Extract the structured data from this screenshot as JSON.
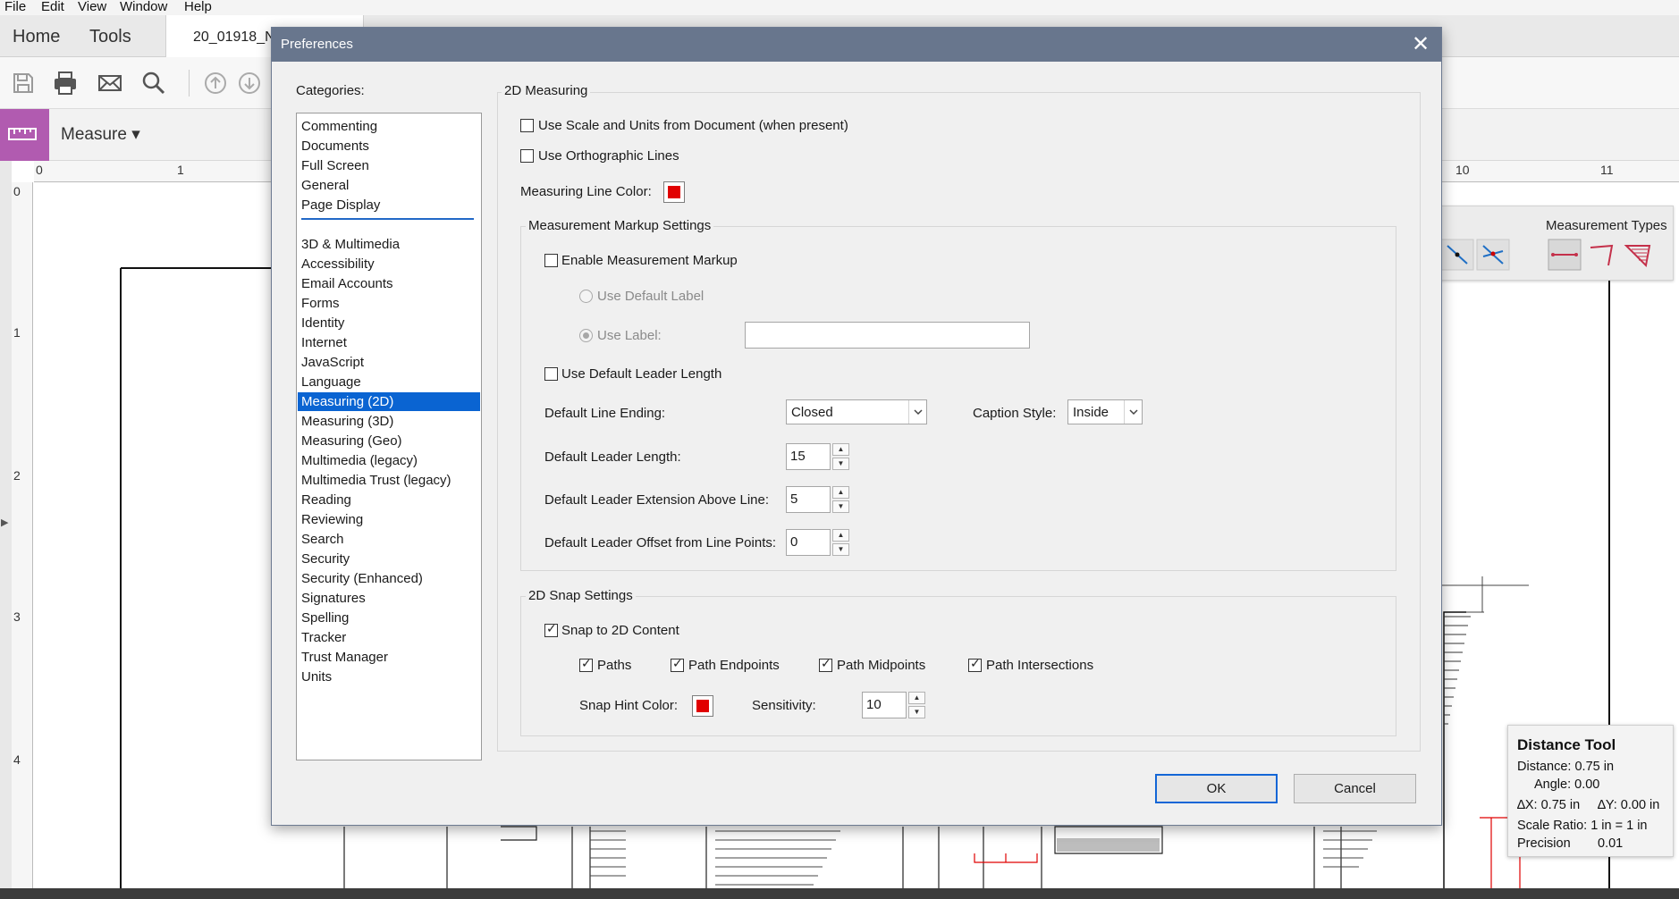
{
  "app": {
    "menu": [
      "File",
      "Edit",
      "View",
      "Window",
      "Help"
    ],
    "tabs": {
      "home": "Home",
      "tools": "Tools",
      "document": "20_01918_N"
    },
    "toolbar_icons": [
      "save-icon",
      "print-icon",
      "email-icon",
      "search-icon",
      "page-up-icon",
      "page-down-icon"
    ],
    "measure_bar": {
      "label": "Measure ▾"
    },
    "ruler_top": [
      "0",
      "1",
      "10",
      "11"
    ],
    "ruler_left": [
      "0",
      "1",
      "2",
      "3",
      "4"
    ],
    "measurement_types_panel": {
      "title": "Measurement Types"
    },
    "distance_tool": {
      "title": "Distance Tool",
      "distance": "Distance: 0.75 in",
      "angle": "Angle: 0.00",
      "delta_x": "∆X: 0.75 in",
      "delta_y": "∆Y: 0.00 in",
      "scale_ratio": "Scale Ratio: 1 in = 1 in",
      "precision": "Precision",
      "precision_value": "0.01"
    }
  },
  "dialog": {
    "title": "Preferences",
    "close_glyph": "✕",
    "categories_label": "Categories:",
    "categories_top": [
      "Commenting",
      "Documents",
      "Full Screen",
      "General",
      "Page Display"
    ],
    "categories_bottom": [
      "3D & Multimedia",
      "Accessibility",
      "Email Accounts",
      "Forms",
      "Identity",
      "Internet",
      "JavaScript",
      "Language",
      "Measuring (2D)",
      "Measuring (3D)",
      "Measuring (Geo)",
      "Multimedia (legacy)",
      "Multimedia Trust (legacy)",
      "Reading",
      "Reviewing",
      "Search",
      "Security",
      "Security (Enhanced)",
      "Signatures",
      "Spelling",
      "Tracker",
      "Trust Manager",
      "Units"
    ],
    "selected_category": "Measuring (2D)",
    "measuring": {
      "group_title": "2D Measuring",
      "use_scale_units": {
        "label": "Use Scale and Units from Document (when present)",
        "checked": false
      },
      "use_orthographic": {
        "label": "Use Orthographic Lines",
        "checked": false
      },
      "line_color": {
        "label": "Measuring Line Color:",
        "color": "#e10000"
      }
    },
    "markup": {
      "group_title": "Measurement Markup Settings",
      "enable_markup": {
        "label": "Enable Measurement Markup",
        "checked": false
      },
      "use_default_label": "Use Default Label",
      "use_label": "Use Label:",
      "label_value": "",
      "use_default_leader": {
        "label": "Use Default Leader Length",
        "checked": false
      },
      "line_ending": {
        "label": "Default Line Ending:",
        "value": "Closed"
      },
      "caption_style": {
        "label": "Caption Style:",
        "value": "Inside"
      },
      "leader_length": {
        "label": "Default Leader Length:",
        "value": "15"
      },
      "leader_extension": {
        "label": "Default Leader Extension Above Line:",
        "value": "5"
      },
      "leader_offset": {
        "label": "Default Leader Offset from Line Points:",
        "value": "0"
      }
    },
    "snap": {
      "group_title": "2D Snap Settings",
      "snap_to_content": {
        "label": "Snap to 2D Content",
        "checked": true
      },
      "paths": {
        "label": "Paths",
        "checked": true
      },
      "path_endpoints": {
        "label": "Path Endpoints",
        "checked": true
      },
      "path_midpoints": {
        "label": "Path Midpoints",
        "checked": true
      },
      "path_intersections": {
        "label": "Path Intersections",
        "checked": true
      },
      "hint_color": {
        "label": "Snap Hint Color:",
        "color": "#e10000"
      },
      "sensitivity": {
        "label": "Sensitivity:",
        "value": "10"
      }
    },
    "buttons": {
      "ok": "OK",
      "cancel": "Cancel"
    }
  }
}
